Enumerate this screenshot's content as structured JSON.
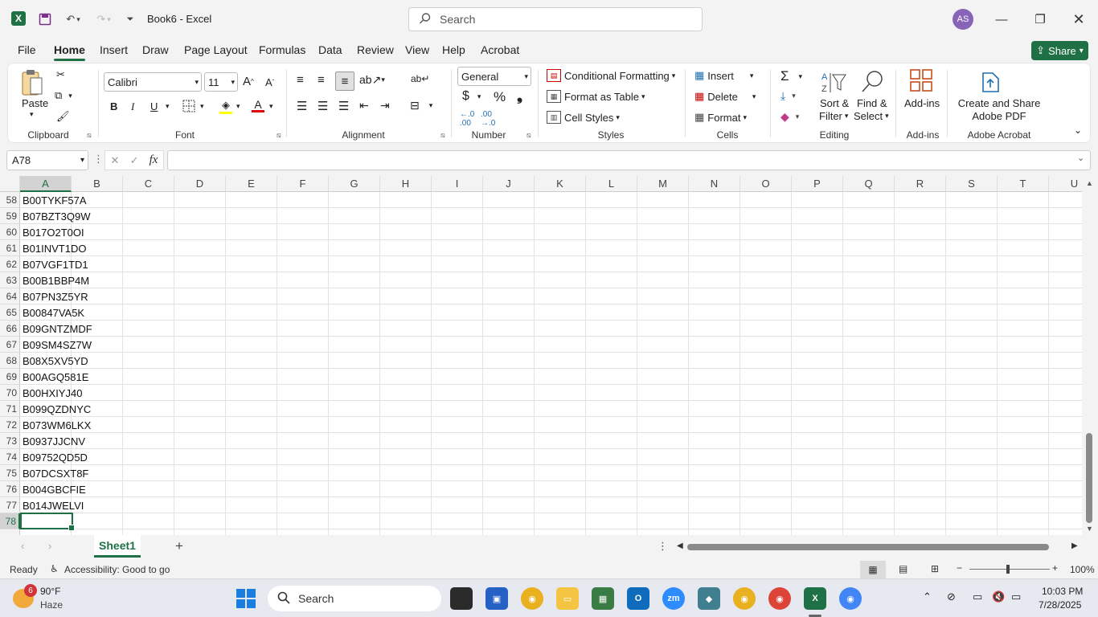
{
  "app": {
    "title": "Book6  -  Excel",
    "search_placeholder": "Search",
    "avatar_initials": "AS"
  },
  "menu": {
    "tabs": [
      "File",
      "Home",
      "Insert",
      "Draw",
      "Page Layout",
      "Formulas",
      "Data",
      "Review",
      "View",
      "Help",
      "Acrobat"
    ],
    "active": "Home",
    "share_label": "Share"
  },
  "ribbon": {
    "clipboard": {
      "paste": "Paste",
      "label": "Clipboard"
    },
    "font": {
      "name": "Calibri",
      "size": "11",
      "label": "Font",
      "bold": "B",
      "italic": "I",
      "underline": "U"
    },
    "alignment": {
      "label": "Alignment"
    },
    "number": {
      "format": "General",
      "label": "Number"
    },
    "styles": {
      "conditional": "Conditional Formatting",
      "table": "Format as Table",
      "cell_styles": "Cell Styles",
      "label": "Styles"
    },
    "cells": {
      "insert": "Insert",
      "delete": "Delete",
      "format": "Format",
      "label": "Cells"
    },
    "editing": {
      "sort": "Sort &",
      "filter": "Filter",
      "find": "Find &",
      "select": "Select",
      "label": "Editing"
    },
    "addins": {
      "btn": "Add-ins",
      "label": "Add-ins"
    },
    "acrobat": {
      "line1": "Create and Share",
      "line2": "Adobe PDF",
      "label": "Adobe Acrobat"
    }
  },
  "formula_bar": {
    "name_box": "A78",
    "fx": "fx",
    "value": ""
  },
  "grid": {
    "columns": [
      "A",
      "B",
      "C",
      "D",
      "E",
      "F",
      "G",
      "H",
      "I",
      "J",
      "K",
      "L",
      "M",
      "N",
      "O",
      "P",
      "Q",
      "R",
      "S",
      "T",
      "U"
    ],
    "selected_column": "A",
    "rows": [
      {
        "n": "58",
        "a": "B00TYKF57A"
      },
      {
        "n": "59",
        "a": "B07BZT3Q9W"
      },
      {
        "n": "60",
        "a": "B017O2T0OI"
      },
      {
        "n": "61",
        "a": "B01INVT1DO"
      },
      {
        "n": "62",
        "a": "B07VGF1TD1"
      },
      {
        "n": "63",
        "a": "B00B1BBP4M"
      },
      {
        "n": "64",
        "a": "B07PN3Z5YR"
      },
      {
        "n": "65",
        "a": "B00847VA5K"
      },
      {
        "n": "66",
        "a": "B09GNTZMDF"
      },
      {
        "n": "67",
        "a": "B09SM4SZ7W"
      },
      {
        "n": "68",
        "a": "B08X5XV5YD"
      },
      {
        "n": "69",
        "a": "B00AGQ581E"
      },
      {
        "n": "70",
        "a": "B00HXIYJ40"
      },
      {
        "n": "71",
        "a": "B099QZDNYC"
      },
      {
        "n": "72",
        "a": "B073WM6LKX"
      },
      {
        "n": "73",
        "a": "B0937JJCNV"
      },
      {
        "n": "74",
        "a": "B09752QD5D"
      },
      {
        "n": "75",
        "a": "B07DCSXT8F"
      },
      {
        "n": "76",
        "a": "B004GBCFIE"
      },
      {
        "n": "77",
        "a": "B014JWELVI"
      },
      {
        "n": "78",
        "a": ""
      }
    ],
    "selected_row": "78"
  },
  "sheets": {
    "tabs": [
      "Sheet1"
    ],
    "add": "+"
  },
  "status": {
    "ready": "Ready",
    "accessibility": "Accessibility: Good to go",
    "zoom": "100%"
  },
  "taskbar": {
    "weather_temp": "90°F",
    "weather_desc": "Haze",
    "weather_badge": "6",
    "search": "Search",
    "time": "10:03 PM",
    "date": "7/28/2025"
  },
  "colors": {
    "accent": "#1f7145",
    "avatar": "#8764b8"
  }
}
